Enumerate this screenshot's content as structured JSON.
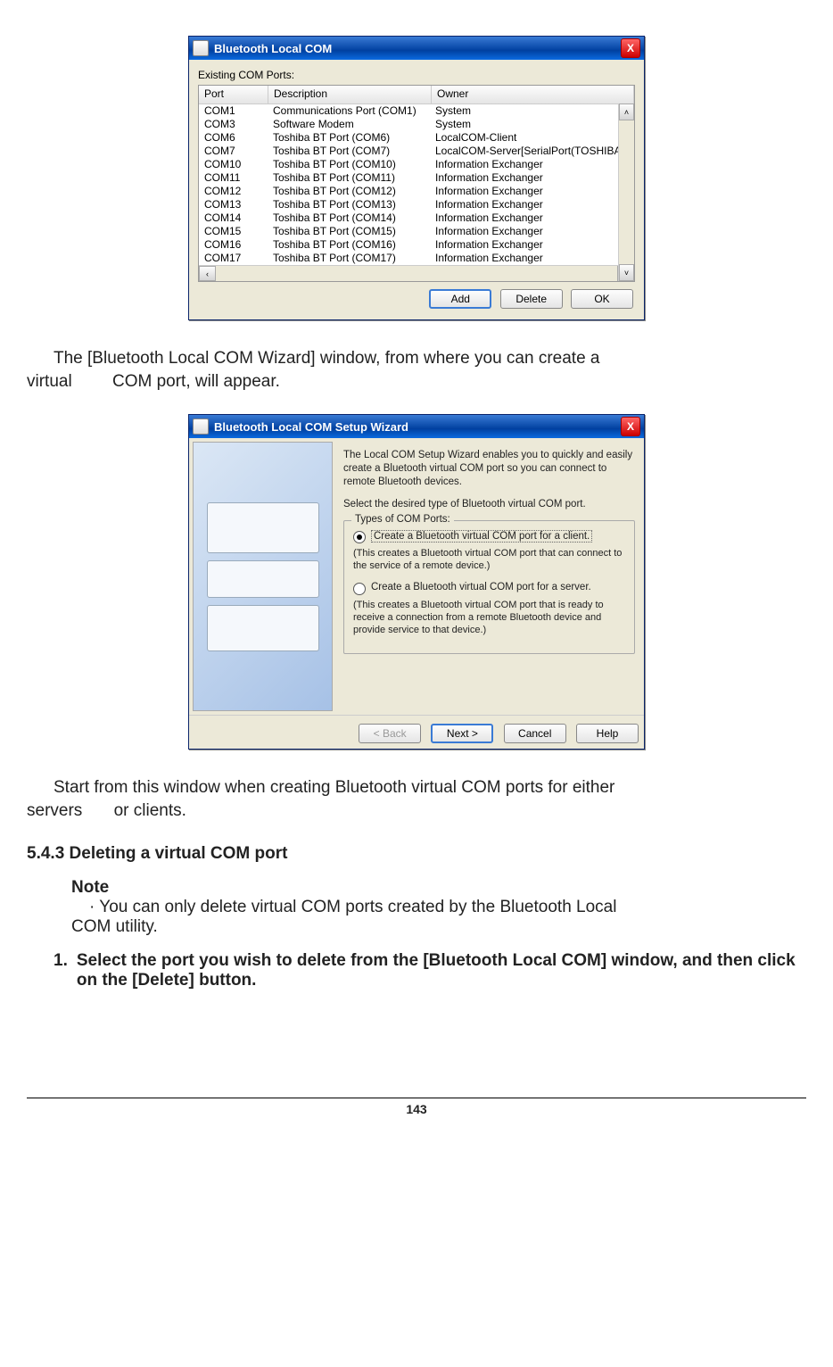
{
  "dialog1": {
    "title": "Bluetooth Local COM",
    "label": "Existing COM Ports:",
    "columns": {
      "c1": "Port",
      "c2": "Description",
      "c3": "Owner"
    },
    "rows": [
      {
        "port": "COM1",
        "desc": "Communications Port (COM1)",
        "owner": "System"
      },
      {
        "port": "COM3",
        "desc": "Software Modem",
        "owner": "System"
      },
      {
        "port": "COM6",
        "desc": "Toshiba BT Port (COM6)",
        "owner": "LocalCOM-Client"
      },
      {
        "port": "COM7",
        "desc": "Toshiba BT Port (COM7)",
        "owner": "LocalCOM-Server[SerialPort(TOSHIBA"
      },
      {
        "port": "COM10",
        "desc": "Toshiba BT Port (COM10)",
        "owner": "Information Exchanger"
      },
      {
        "port": "COM11",
        "desc": "Toshiba BT Port (COM11)",
        "owner": "Information Exchanger"
      },
      {
        "port": "COM12",
        "desc": "Toshiba BT Port (COM12)",
        "owner": "Information Exchanger"
      },
      {
        "port": "COM13",
        "desc": "Toshiba BT Port (COM13)",
        "owner": "Information Exchanger"
      },
      {
        "port": "COM14",
        "desc": "Toshiba BT Port (COM14)",
        "owner": "Information Exchanger"
      },
      {
        "port": "COM15",
        "desc": "Toshiba BT Port (COM15)",
        "owner": "Information Exchanger"
      },
      {
        "port": "COM16",
        "desc": "Toshiba BT Port (COM16)",
        "owner": "Information Exchanger"
      },
      {
        "port": "COM17",
        "desc": "Toshiba BT Port (COM17)",
        "owner": "Information Exchanger"
      }
    ],
    "buttons": {
      "add": "Add",
      "delete": "Delete",
      "ok": "OK"
    },
    "scroll": {
      "up": "˄",
      "down": "˅",
      "left": "‹",
      "right": "›"
    },
    "close": "X"
  },
  "para1a": "The [Bluetooth Local COM Wizard] window, from where you can create a",
  "para1b_left": "virtual",
  "para1b_right": "COM port, will appear.",
  "dialog2": {
    "title": "Bluetooth Local COM Setup Wizard",
    "close": "X",
    "intro1": "The Local COM Setup Wizard enables you to quickly and easily create a Bluetooth virtual COM port so you can connect to remote Bluetooth devices.",
    "intro2": "Select the desired type of Bluetooth virtual COM port.",
    "groupTitle": "Types of COM Ports:",
    "opt1_label": "Create a Bluetooth virtual COM port for a client.",
    "opt1_desc": "(This creates a Bluetooth virtual COM port that can connect to the service of a remote device.)",
    "opt2_label": "Create a Bluetooth virtual COM port for a server.",
    "opt2_desc": "(This creates a Bluetooth virtual COM port that is ready to receive a connection from a remote Bluetooth device and provide service to that device.)",
    "buttons": {
      "back": "< Back",
      "next": "Next >",
      "cancel": "Cancel",
      "help": "Help"
    }
  },
  "para2a": "Start from this window when creating Bluetooth virtual COM ports for either",
  "para2b_left": "servers",
  "para2b_right": "or clients.",
  "section": "5.4.3   Deleting a virtual COM port",
  "note_head": "Note",
  "note_body_a": "· You can only delete virtual COM ports created by the Bluetooth Local",
  "note_body_b": "COM  utility.",
  "step_num": "1.",
  "step_text": "Select the port you wish to delete from the [Bluetooth Local COM] window, and then click on the [Delete] button.",
  "page_number": "143"
}
